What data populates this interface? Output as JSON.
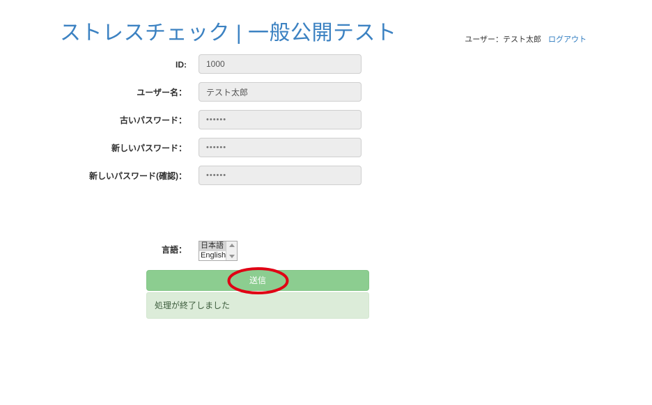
{
  "page": {
    "title": "ストレスチェック | 一般公開テスト",
    "title_color": "#3c82c2",
    "background": "#ffffff"
  },
  "user_bar": {
    "user_text": "ユーザー：テスト太郎",
    "logout_label": "ログアウト",
    "link_color": "#2f7cc0"
  },
  "form": {
    "rows": [
      {
        "label": "ID:",
        "value": "1000",
        "type": "text"
      },
      {
        "label": "ユーザー名：",
        "value": "テスト太郎",
        "type": "text"
      },
      {
        "label": "古いパスワード：",
        "value": "••••••",
        "type": "password"
      },
      {
        "label": "新しいパスワード：",
        "value": "••••••",
        "type": "password"
      },
      {
        "label": "新しいパスワード(確認)：",
        "value": "••••••",
        "type": "password"
      }
    ],
    "language": {
      "label": "言語：",
      "options": [
        "日本語",
        "English"
      ],
      "selected": "日本語"
    },
    "submit_label": "送信",
    "submit_color": "#8ccd90"
  },
  "result": {
    "message": "処理が終了しました",
    "background": "#dcecd9"
  },
  "annotation": {
    "shape": "ellipse",
    "color": "#e00014",
    "target": "送信"
  }
}
